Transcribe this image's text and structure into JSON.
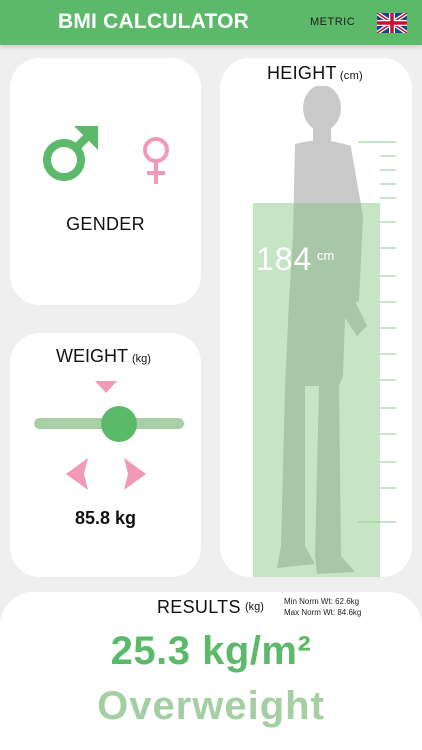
{
  "header": {
    "title": "BMI CALCULATOR",
    "unit_toggle": "METRIC",
    "flag_icon": "uk-flag-icon"
  },
  "gender": {
    "label": "GENDER",
    "male_icon": "male-symbol-icon",
    "female_icon": "female-symbol-icon"
  },
  "weight": {
    "title": "WEIGHT",
    "unit": "(kg)",
    "value": "85.8 kg",
    "slider_position": 0.58
  },
  "height": {
    "title": "HEIGHT",
    "unit": "(cm)",
    "value": "184",
    "value_unit": "cm"
  },
  "results": {
    "title": "RESULTS",
    "unit": "(kg)",
    "min_norm": "Min Norm Wt: 62.6kg",
    "max_norm": "Max Norm Wt: 84.6kg",
    "bmi": "25.3 kg/m²",
    "classification": "Overweight"
  },
  "colors": {
    "brand_green": "#5cb96a",
    "pink_accent": "#f09ab8",
    "light_green": "#a3cfa3",
    "background": "#efefef"
  }
}
